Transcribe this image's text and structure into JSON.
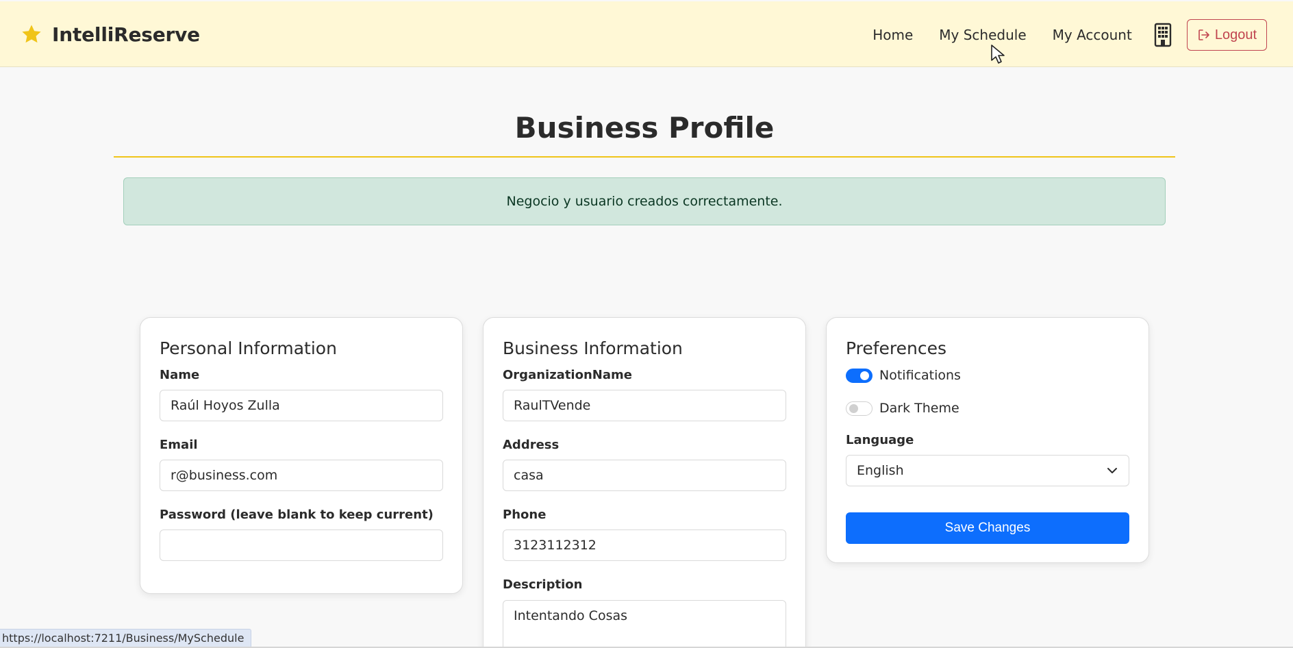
{
  "nav": {
    "brand": "IntelliReserve",
    "links": [
      "Home",
      "My Schedule",
      "My Account"
    ],
    "logout_label": "Logout"
  },
  "page": {
    "title": "Business Profile",
    "alert": "Negocio y usuario creados correctamente."
  },
  "personal": {
    "title": "Personal Information",
    "name_label": "Name",
    "name_value": "Raúl Hoyos Zulla",
    "email_label": "Email",
    "email_value": "r@business.com",
    "password_label": "Password (leave blank to keep current)",
    "password_value": ""
  },
  "business": {
    "title": "Business Information",
    "org_label": "OrganizationName",
    "org_value": "RaulTVende",
    "address_label": "Address",
    "address_value": "casa",
    "phone_label": "Phone",
    "phone_value": "3123112312",
    "description_label": "Description",
    "description_value": "Intentando Cosas"
  },
  "preferences": {
    "title": "Preferences",
    "notifications_label": "Notifications",
    "notifications_on": true,
    "dark_theme_label": "Dark Theme",
    "dark_theme_on": false,
    "language_label": "Language",
    "language_value": "English",
    "save_label": "Save Changes"
  },
  "status_bar": {
    "url": "https://localhost:7211/Business/MySchedule"
  },
  "colors": {
    "navbar_bg": "#fff8d6",
    "accent_yellow": "#f0c419",
    "primary": "#0d6efd",
    "danger": "#c0444f",
    "alert_bg": "#d1e7dd"
  },
  "icons": {
    "brand": "star-icon",
    "business": "building-icon",
    "logout": "logout-icon",
    "select": "chevron-down-icon"
  }
}
